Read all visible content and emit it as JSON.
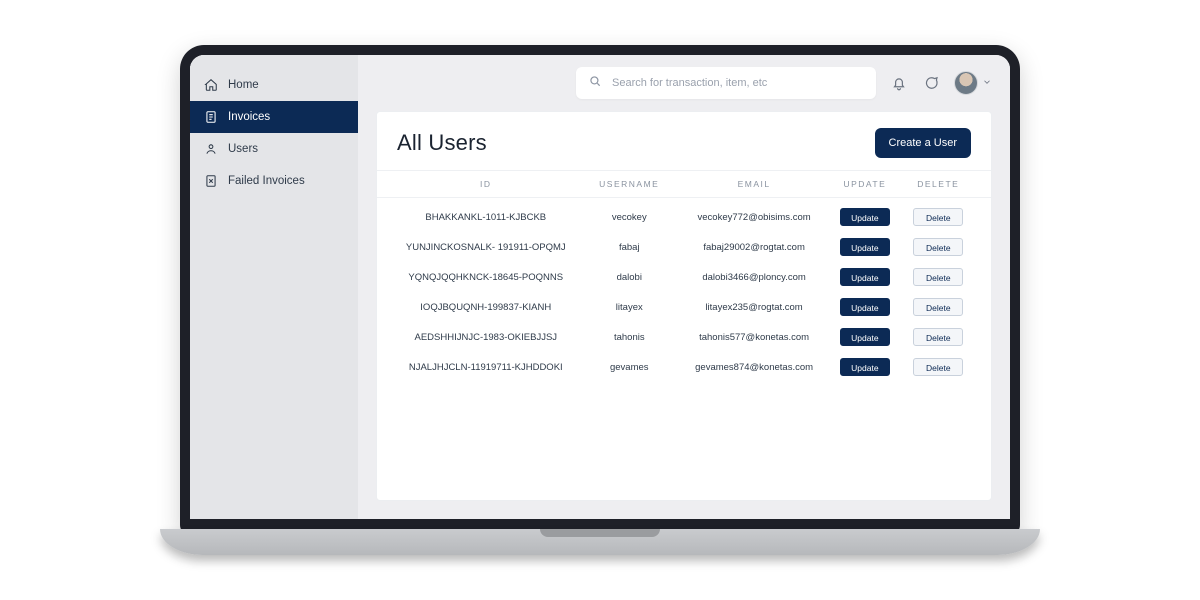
{
  "sidebar": {
    "items": [
      {
        "label": "Home",
        "icon": "home-icon",
        "active": false
      },
      {
        "label": "Invoices",
        "icon": "invoice-icon",
        "active": true
      },
      {
        "label": "Users",
        "icon": "user-icon",
        "active": false
      },
      {
        "label": "Failed Invoices",
        "icon": "failed-invoice-icon",
        "active": false
      }
    ]
  },
  "topbar": {
    "search_placeholder": "Search for transaction, item, etc"
  },
  "page": {
    "title": "All Users",
    "create_button_label": "Create a User"
  },
  "table": {
    "columns": {
      "id": "ID",
      "username": "USERNAME",
      "email": "EMAIL",
      "update": "UPDATE",
      "delete": "DELETE"
    },
    "update_label": "Update",
    "delete_label": "Delete",
    "rows": [
      {
        "id": "BHAKKANKL-1011-KJBCKB",
        "username": "vecokey",
        "email": "vecokey772@obisims.com"
      },
      {
        "id": "YUNJINCKOSNALK- 191911-OPQMJ",
        "username": "fabaj",
        "email": "fabaj29002@rogtat.com"
      },
      {
        "id": "YQNQJQQHKNCK-18645-POQNNS",
        "username": "dalobi",
        "email": "dalobi3466@ploncy.com"
      },
      {
        "id": "IOQJBQUQNH-199837-KIANH",
        "username": "litayex",
        "email": "litayex235@rogtat.com"
      },
      {
        "id": "AEDSHHIJNJC-1983-OKIEBJJSJ",
        "username": "tahonis",
        "email": "tahonis577@konetas.com"
      },
      {
        "id": "NJALJHJCLN-11919711-KJHDDOKI",
        "username": "gevames",
        "email": "gevames874@konetas.com"
      }
    ]
  }
}
